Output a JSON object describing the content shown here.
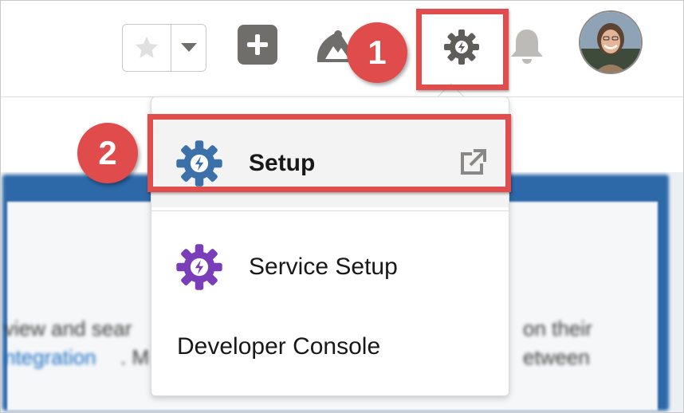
{
  "header": {
    "favorites_star_icon": "star-icon",
    "favorites_dropdown_icon": "chevron-down-icon",
    "global_add_icon": "plus-icon",
    "trailhead_icon": "trailhead-icon",
    "setup_gear_icon": "gear-icon",
    "notifications_icon": "bell-icon",
    "avatar": "user-avatar"
  },
  "callouts": {
    "step1": "1",
    "step2": "2"
  },
  "setup_menu": {
    "items": [
      {
        "label": "Setup",
        "icon": "setup-gear-icon",
        "trailing_icon": "external-link-icon",
        "color": "#3c70a8"
      },
      {
        "label": "Service Setup",
        "icon": "service-setup-gear-icon",
        "color": "#7a3fb8"
      },
      {
        "label": "Developer Console"
      }
    ]
  },
  "background": {
    "line1_text": "view and sear",
    "line1_end": "on their",
    "line2_link": "ntegration",
    "line2_text": ". M",
    "line2_end": "etween"
  },
  "colors": {
    "callout": "#e14c4d",
    "header_icons": "#706e6b",
    "banner": "#2d68a9"
  }
}
